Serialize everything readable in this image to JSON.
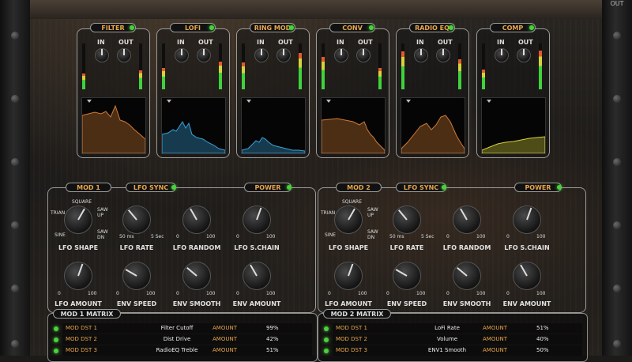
{
  "header": {
    "out_label": "OUT"
  },
  "fx": [
    {
      "name": "FILTER",
      "in": "IN",
      "out": "OUT"
    },
    {
      "name": "LOFI",
      "in": "IN",
      "out": "OUT"
    },
    {
      "name": "RING MOD",
      "in": "IN",
      "out": "OUT"
    },
    {
      "name": "CONV",
      "in": "IN",
      "out": "OUT"
    },
    {
      "name": "RADIO EQ",
      "in": "IN",
      "out": "OUT"
    },
    {
      "name": "COMP",
      "in": "IN",
      "out": "OUT"
    }
  ],
  "mod1": {
    "title": "MOD 1",
    "sync": "LFO SYNC",
    "power": "POWER",
    "shape_labels": {
      "square": "SQUARE",
      "trian": "TRIAN",
      "saw_up": "SAW UP",
      "sine": "SINE",
      "saw_dn": "SAW DN"
    },
    "rate_scale": {
      "min": "50 ms",
      "max": "5 Sec"
    },
    "knobs": {
      "lfo_shape": "LFO SHAPE",
      "lfo_rate": "LFO RATE",
      "lfo_random": "LFO RANDOM",
      "lfo_schain": "LFO S.CHAIN",
      "lfo_amount": "LFO AMOUNT",
      "env_speed": "ENV SPEED",
      "env_smooth": "ENV SMOOTH",
      "env_amount": "ENV AMOUNT"
    },
    "scale": {
      "min": "0",
      "max": "100"
    },
    "matrix_title": "MOD 1 MATRIX",
    "rows": [
      {
        "dst": "MOD DST 1",
        "target": "Filter Cutoff",
        "amount_label": "AMOUNT",
        "value": "99%"
      },
      {
        "dst": "MOD DST 2",
        "target": "Dist Drive",
        "amount_label": "AMOUNT",
        "value": "42%"
      },
      {
        "dst": "MOD DST 3",
        "target": "RadioEQ Treble",
        "amount_label": "AMOUNT",
        "value": "51%"
      }
    ]
  },
  "mod2": {
    "title": "MOD 2",
    "sync": "LFO SYNC",
    "power": "POWER",
    "shape_labels": {
      "square": "SQUARE",
      "trian": "TRIAN",
      "saw_up": "SAW UP",
      "sine": "SINE",
      "saw_dn": "SAW DN"
    },
    "rate_scale": {
      "min": "50 ms",
      "max": "5 Sec"
    },
    "knobs": {
      "lfo_shape": "LFO SHAPE",
      "lfo_rate": "LFO RATE",
      "lfo_random": "LFO RANDOM",
      "lfo_schain": "LFO S.CHAIN",
      "lfo_amount": "LFO AMOUNT",
      "env_speed": "ENV SPEED",
      "env_smooth": "ENV SMOOTH",
      "env_amount": "ENV AMOUNT"
    },
    "scale": {
      "min": "0",
      "max": "100"
    },
    "matrix_title": "MOD 2 MATRIX",
    "rows": [
      {
        "dst": "MOD DST 1",
        "target": "LoFi Rate",
        "amount_label": "AMOUNT",
        "value": "51%"
      },
      {
        "dst": "MOD DST 2",
        "target": "Volume",
        "amount_label": "AMOUNT",
        "value": "40%"
      },
      {
        "dst": "MOD DST 3",
        "target": "ENV1 Smooth",
        "amount_label": "AMOUNT",
        "value": "50%"
      }
    ]
  },
  "colors": {
    "accent": "#e9a54a",
    "led": "#49d23c",
    "display_blue": "#3aa0d8",
    "display_orange": "#d07b35",
    "display_yellow": "#d7d23a"
  }
}
